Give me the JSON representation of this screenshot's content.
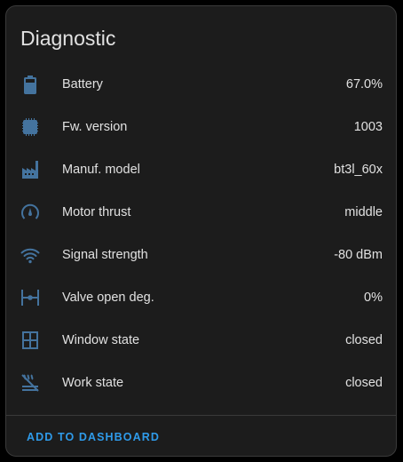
{
  "card": {
    "title": "Diagnostic",
    "action_label": "ADD TO DASHBOARD"
  },
  "colors": {
    "icon": "#44739e",
    "action": "#2f9bea",
    "card_bg": "#1c1c1c",
    "text": "#e1e1e1"
  },
  "rows": [
    {
      "icon": "battery-icon",
      "label": "Battery",
      "value": "67.0%"
    },
    {
      "icon": "chip-icon",
      "label": "Fw. version",
      "value": "1003"
    },
    {
      "icon": "factory-icon",
      "label": "Manuf. model",
      "value": "bt3l_60x"
    },
    {
      "icon": "speedometer-icon",
      "label": "Motor thrust",
      "value": "middle"
    },
    {
      "icon": "wifi-icon",
      "label": "Signal strength",
      "value": "-80 dBm"
    },
    {
      "icon": "valve-icon",
      "label": "Valve open deg.",
      "value": "0%"
    },
    {
      "icon": "window-icon",
      "label": "Window state",
      "value": "closed"
    },
    {
      "icon": "heating-off-icon",
      "label": "Work state",
      "value": "closed"
    }
  ]
}
